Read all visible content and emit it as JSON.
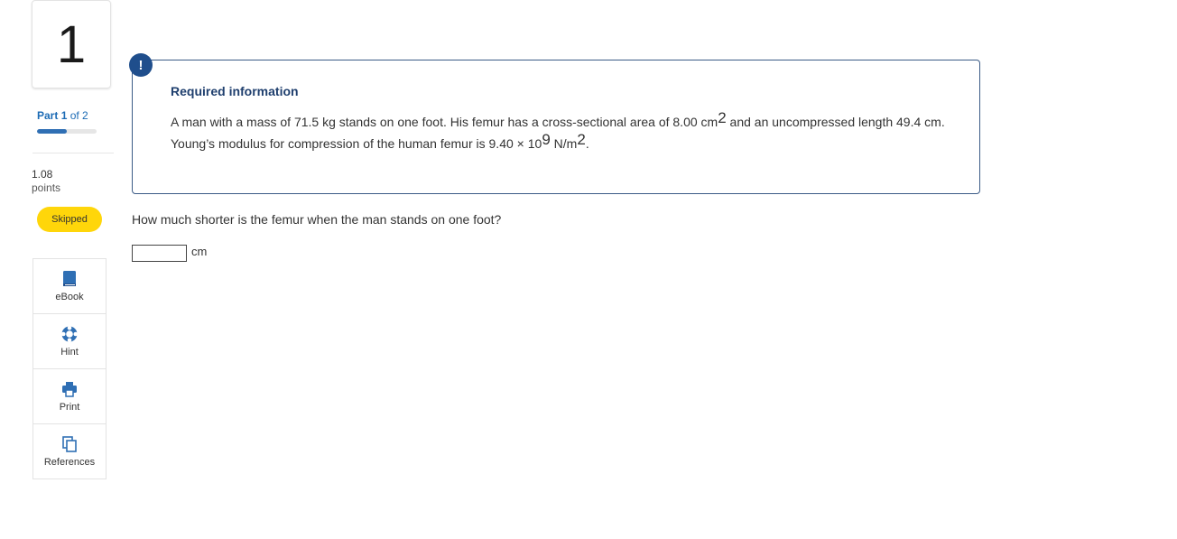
{
  "question": {
    "number": "1",
    "part_label": "Part",
    "part_current": "1",
    "part_of": "of 2",
    "progress_fraction": 0.5,
    "points_value": "1.08",
    "points_unit": "points",
    "status": "Skipped"
  },
  "tools": [
    {
      "label": "eBook",
      "icon": "book-icon"
    },
    {
      "label": "Hint",
      "icon": "lifebuoy-icon"
    },
    {
      "label": "Print",
      "icon": "printer-icon"
    },
    {
      "label": "References",
      "icon": "copy-icon"
    }
  ],
  "info": {
    "alert_symbol": "!",
    "title": "Required information",
    "text_part1": "A man with a mass of 71.5 kg stands on one foot. His femur has a cross-sectional area of 8.00 cm",
    "sup1": "2",
    "text_part2": " and an uncompressed length 49.4 cm. Young’s modulus for compression of the human femur is 9.40 × 10",
    "sup2": "9",
    "text_part3": " N/m",
    "sup3": "2",
    "text_part4": "."
  },
  "prompt": "How much shorter is the femur when the man stands on one foot?",
  "answer": {
    "value": "",
    "unit": "cm"
  },
  "colors": {
    "accent_blue": "#1c6bb5",
    "navy": "#1f4e8c",
    "status_yellow": "#ffd60a",
    "icon_blue": "#2f6fb4"
  }
}
